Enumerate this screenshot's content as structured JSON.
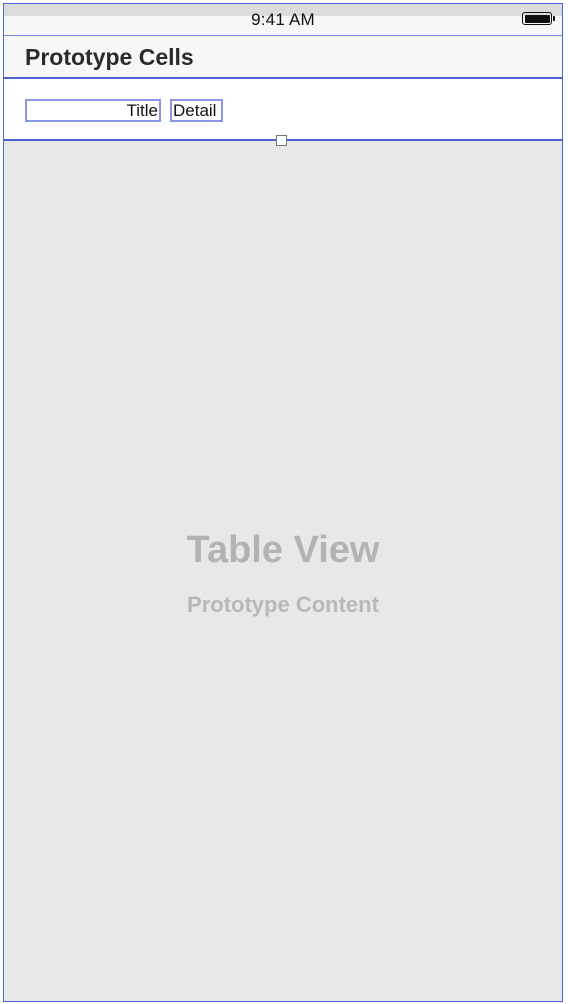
{
  "status_bar": {
    "time": "9:41 AM",
    "battery_icon": "battery-full-icon"
  },
  "section": {
    "title": "Prototype Cells"
  },
  "prototype_cell": {
    "title_label": "Title",
    "detail_label": "Detail"
  },
  "table_view": {
    "title": "Table View",
    "subtitle": "Prototype Content"
  },
  "colors": {
    "selection_outline": "#4a63d8",
    "label_outline": "#8a97e6",
    "canvas_background": "#e8e8e8",
    "placeholder_text": "#b3b3b3"
  }
}
